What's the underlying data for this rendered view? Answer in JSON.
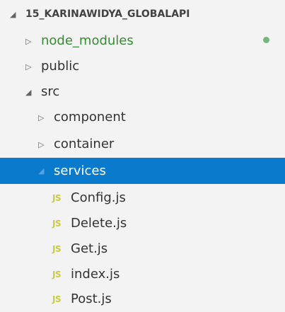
{
  "explorer": {
    "root": {
      "label": "15_KARINAWIDYA_GLOBALAPI",
      "expanded": true
    },
    "items": [
      {
        "label": "node_modules",
        "kind": "folder",
        "expanded": false,
        "git_status": "untracked"
      },
      {
        "label": "public",
        "kind": "folder",
        "expanded": false
      },
      {
        "label": "src",
        "kind": "folder",
        "expanded": true
      },
      {
        "label": "component",
        "kind": "folder",
        "expanded": false
      },
      {
        "label": "container",
        "kind": "folder",
        "expanded": false
      },
      {
        "label": "services",
        "kind": "folder",
        "expanded": true,
        "selected": true
      },
      {
        "label": "Config.js",
        "kind": "file",
        "icon": "JS"
      },
      {
        "label": "Delete.js",
        "kind": "file",
        "icon": "JS"
      },
      {
        "label": "Get.js",
        "kind": "file",
        "icon": "JS"
      },
      {
        "label": "index.js",
        "kind": "file",
        "icon": "JS"
      },
      {
        "label": "Post.js",
        "kind": "file",
        "icon": "JS"
      }
    ]
  },
  "colors": {
    "background": "#f3f3f3",
    "selection": "#0a7acc",
    "untracked_text": "#388a34",
    "js_icon": "#cbcb41"
  }
}
